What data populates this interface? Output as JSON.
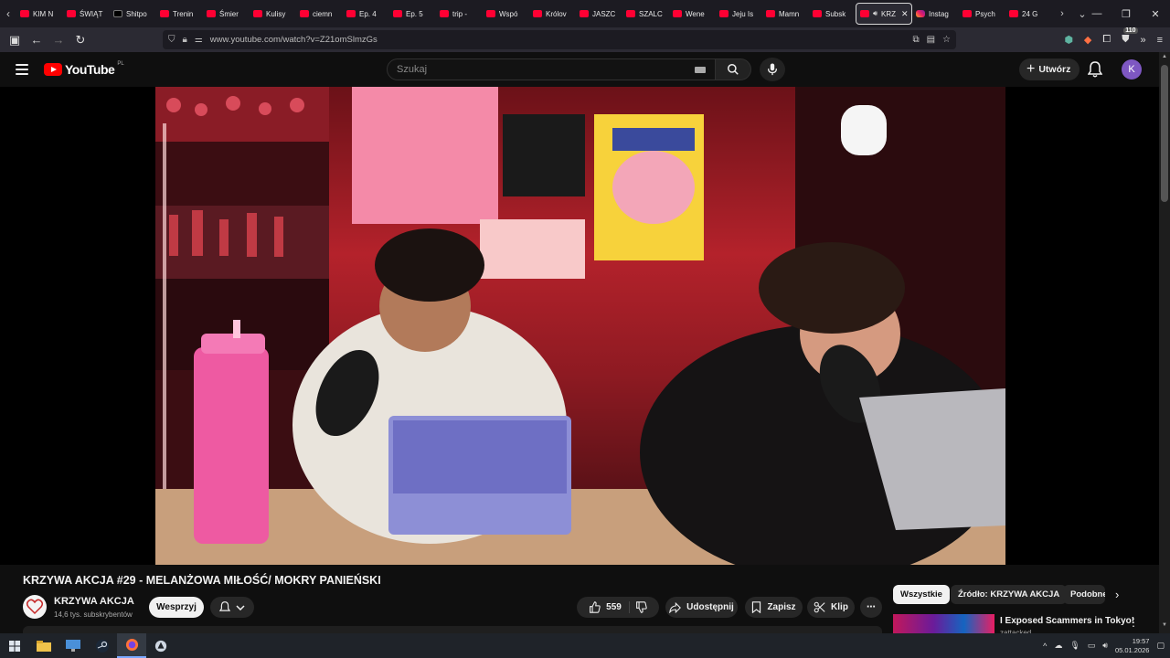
{
  "browser": {
    "tabs": [
      {
        "label": "KIM N",
        "icon": "youtube-favicon"
      },
      {
        "label": "ŚWIĄT",
        "icon": "youtube-favicon"
      },
      {
        "label": "Shitpo",
        "icon": "x-favicon"
      },
      {
        "label": "Trenin",
        "icon": "youtube-favicon"
      },
      {
        "label": "Śmier",
        "icon": "youtube-favicon"
      },
      {
        "label": "Kulisy",
        "icon": "youtube-favicon"
      },
      {
        "label": "ciemn",
        "icon": "youtube-favicon"
      },
      {
        "label": "Ep. 4",
        "icon": "youtube-favicon"
      },
      {
        "label": "Ep. 5",
        "icon": "youtube-favicon"
      },
      {
        "label": "trip -",
        "icon": "youtube-favicon"
      },
      {
        "label": "Wspó",
        "icon": "youtube-favicon"
      },
      {
        "label": "Królov",
        "icon": "youtube-favicon"
      },
      {
        "label": "JASZC",
        "icon": "youtube-favicon"
      },
      {
        "label": "SZALC",
        "icon": "youtube-favicon"
      },
      {
        "label": "Wene",
        "icon": "youtube-favicon"
      },
      {
        "label": "Jeju Is",
        "icon": "youtube-favicon"
      },
      {
        "label": "Mamn",
        "icon": "youtube-favicon"
      },
      {
        "label": "Subsk",
        "icon": "youtube-favicon"
      }
    ],
    "active_tab": {
      "label": "KRZ",
      "icon": "youtube-favicon"
    },
    "tabs_after": [
      {
        "label": "Instag",
        "icon": "instagram-favicon"
      },
      {
        "label": "Psych",
        "icon": "youtube-favicon"
      },
      {
        "label": "24 G",
        "icon": "youtube-favicon"
      }
    ],
    "url": "www.youtube.com/watch?v=Z21omSlmzGs",
    "extensions_badge": "110"
  },
  "youtube": {
    "logo_text": "YouTube",
    "country_code": "PL",
    "search_placeholder": "Szukaj",
    "create_label": "Utwórz",
    "account_initial": "K"
  },
  "video": {
    "title": "KRZYWA AKCJA #29 - MELANŻOWA MIŁOŚĆ/ MOKRY PANIEŃSKI",
    "channel_name": "KRZYWA AKCJA",
    "subscribers": "14,6 tys. subskrybentów",
    "support_label": "Wesprzyj",
    "like_count": "559",
    "share_label": "Udostępnij",
    "save_label": "Zapisz",
    "clip_label": "Klip"
  },
  "sidebar": {
    "chips": [
      "Wszystkie",
      "Źródło: KRZYWA AKCJA",
      "Podobne"
    ],
    "recommendation": {
      "title": "I Exposed Scammers in Tokyo!",
      "channel": "zattacked"
    }
  },
  "taskbar": {
    "time": "19:57",
    "date": "05.01.2026"
  }
}
